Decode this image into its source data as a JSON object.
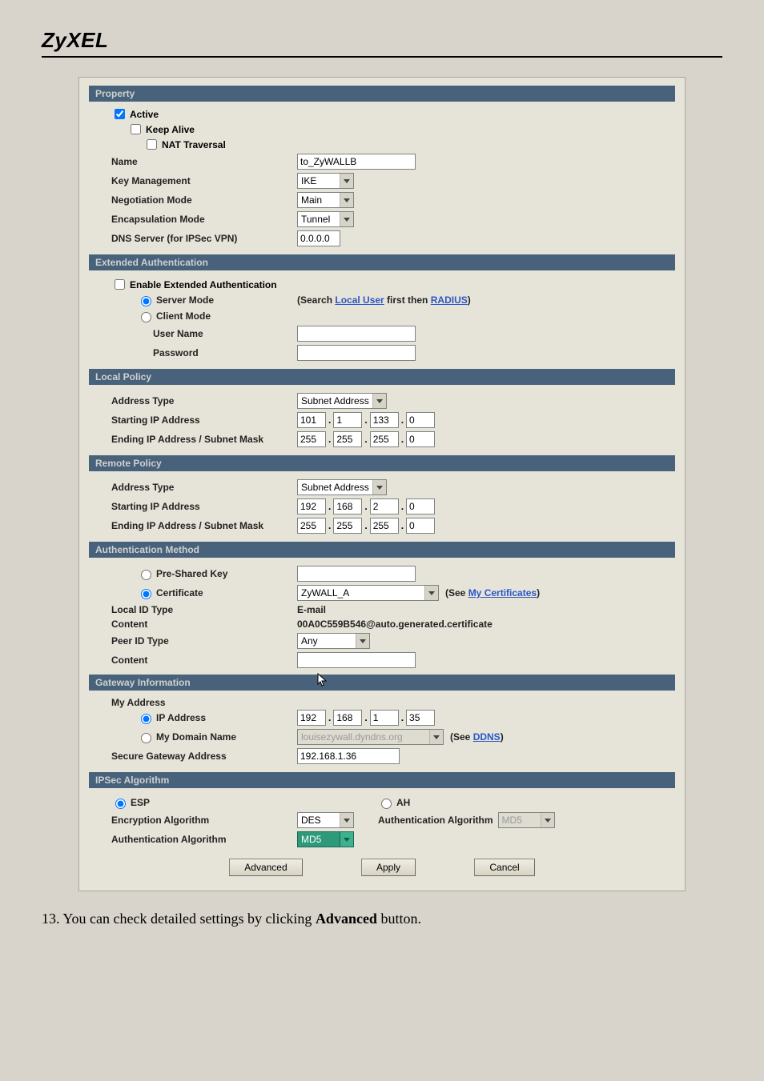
{
  "brand": "ZyXEL",
  "sections": {
    "property": "Property",
    "ext_auth": "Extended Authentication",
    "local_policy": "Local Policy",
    "remote_policy": "Remote Policy",
    "auth_method": "Authentication Method",
    "gateway_info": "Gateway Information",
    "ipsec_alg": "IPSec Algorithm"
  },
  "property": {
    "active_label": "Active",
    "keep_alive_label": "Keep Alive",
    "nat_trav_label": "NAT Traversal",
    "name_label": "Name",
    "name_value": "to_ZyWALLB",
    "key_mgmt_label": "Key Management",
    "key_mgmt_value": "IKE",
    "neg_mode_label": "Negotiation Mode",
    "neg_mode_value": "Main",
    "encap_label": "Encapsulation Mode",
    "encap_value": "Tunnel",
    "dns_label": "DNS Server (for IPSec VPN)",
    "dns_value": "0.0.0.0"
  },
  "ext_auth": {
    "enable_label": "Enable Extended Authentication",
    "server_mode_label": "Server Mode",
    "server_note_prefix": "(Search ",
    "server_note_link1": "Local User",
    "server_note_mid": " first then ",
    "server_note_link2": "RADIUS",
    "server_note_suffix": ")",
    "client_mode_label": "Client Mode",
    "user_label": "User Name",
    "pass_label": "Password"
  },
  "local": {
    "addr_type_label": "Address Type",
    "addr_type_value": "Subnet Address",
    "start_label": "Starting IP Address",
    "start_ip": [
      "101",
      "1",
      "133",
      "0"
    ],
    "end_label": "Ending IP Address / Subnet Mask",
    "end_ip": [
      "255",
      "255",
      "255",
      "0"
    ]
  },
  "remote": {
    "addr_type_label": "Address Type",
    "addr_type_value": "Subnet Address",
    "start_label": "Starting IP Address",
    "start_ip": [
      "192",
      "168",
      "2",
      "0"
    ],
    "end_label": "Ending IP Address / Subnet Mask",
    "end_ip": [
      "255",
      "255",
      "255",
      "0"
    ]
  },
  "auth": {
    "psk_label": "Pre-Shared Key",
    "cert_label": "Certificate",
    "cert_value": "ZyWALL_A",
    "cert_link_prefix": "(See ",
    "cert_link": "My Certificates",
    "cert_link_suffix": ")",
    "local_id_type_label": "Local ID Type",
    "local_id_type_value": "E-mail",
    "content_label": "Content",
    "content_value": "00A0C559B546@auto.generated.certificate",
    "peer_id_type_label": "Peer ID Type",
    "peer_id_type_value": "Any",
    "content2_label": "Content"
  },
  "gateway": {
    "my_addr_label": "My Address",
    "ip_label": "IP Address",
    "ip_value": [
      "192",
      "168",
      "1",
      "35"
    ],
    "domain_label": "My Domain Name",
    "domain_value": "louisezywall.dyndns.org",
    "domain_link_prefix": "(See ",
    "domain_link": "DDNS",
    "domain_link_suffix": ")",
    "sgw_label": "Secure Gateway Address",
    "sgw_value": "192.168.1.36"
  },
  "ipsec": {
    "esp_label": "ESP",
    "ah_label": "AH",
    "enc_label": "Encryption Algorithm",
    "enc_value": "DES",
    "auth2_label": "Authentication Algorithm",
    "auth2_value": "MD5",
    "auth_label": "Authentication Algorithm",
    "auth_value": "MD5"
  },
  "buttons": {
    "advanced": "Advanced",
    "apply": "Apply",
    "cancel": "Cancel"
  },
  "footer": {
    "prefix": "13. You can check detailed settings by clicking ",
    "bold": "Advanced",
    "suffix": " button."
  }
}
